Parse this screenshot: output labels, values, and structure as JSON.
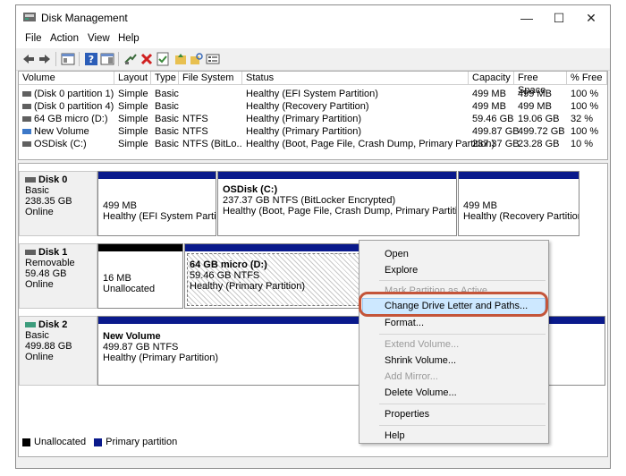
{
  "window": {
    "title": "Disk Management",
    "controls": {
      "minimize": "—",
      "maximize": "☐",
      "close": "✕"
    }
  },
  "menu": [
    "File",
    "Action",
    "View",
    "Help"
  ],
  "table": {
    "headers": [
      "Volume",
      "Layout",
      "Type",
      "File System",
      "Status",
      "Capacity",
      "Free Space",
      "% Free"
    ],
    "rows": [
      [
        "(Disk 0 partition 1)",
        "Simple",
        "Basic",
        "",
        "Healthy (EFI System Partition)",
        "499 MB",
        "499 MB",
        "100 %"
      ],
      [
        "(Disk 0 partition 4)",
        "Simple",
        "Basic",
        "",
        "Healthy (Recovery Partition)",
        "499 MB",
        "499 MB",
        "100 %"
      ],
      [
        "64 GB micro (D:)",
        "Simple",
        "Basic",
        "NTFS",
        "Healthy (Primary Partition)",
        "59.46 GB",
        "19.06 GB",
        "32 %"
      ],
      [
        "New Volume",
        "Simple",
        "Basic",
        "NTFS",
        "Healthy (Primary Partition)",
        "499.87 GB",
        "499.72 GB",
        "100 %"
      ],
      [
        "OSDisk (C:)",
        "Simple",
        "Basic",
        "NTFS (BitLo...",
        "Healthy (Boot, Page File, Crash Dump, Primary Partition)",
        "237.37 GB",
        "23.28 GB",
        "10 %"
      ]
    ]
  },
  "disks": [
    {
      "name": "Disk 0",
      "type": "Basic",
      "size": "238.35 GB",
      "status": "Online",
      "partitions": [
        {
          "title": "",
          "line1": "499 MB",
          "line2": "Healthy (EFI System Partition"
        },
        {
          "title": "OSDisk  (C:)",
          "line1": "237.37 GB NTFS (BitLocker Encrypted)",
          "line2": "Healthy (Boot, Page File, Crash Dump, Primary Partition)"
        },
        {
          "title": "",
          "line1": "499 MB",
          "line2": "Healthy (Recovery Partition)"
        }
      ]
    },
    {
      "name": "Disk 1",
      "type": "Removable",
      "size": "59.48 GB",
      "status": "Online",
      "partitions": [
        {
          "title": "",
          "line1": "16 MB",
          "line2": "Unallocated"
        },
        {
          "title": "64 GB micro  (D:)",
          "line1": "59.46 GB NTFS",
          "line2": "Healthy (Primary Partition)"
        }
      ]
    },
    {
      "name": "Disk 2",
      "type": "Basic",
      "size": "499.88 GB",
      "status": "Online",
      "partitions": [
        {
          "title": "New Volume",
          "line1": "499.87 GB NTFS",
          "line2": "Healthy (Primary Partition)"
        }
      ]
    }
  ],
  "legend": {
    "unallocated": "Unallocated",
    "primary": "Primary partition",
    "unallocated_color": "#000000",
    "primary_color": "#0a1a8c"
  },
  "context_menu": {
    "open": "Open",
    "explore": "Explore",
    "mark_active": "Mark Partition as Active",
    "change_letter": "Change Drive Letter and Paths...",
    "format": "Format...",
    "extend": "Extend Volume...",
    "shrink": "Shrink Volume...",
    "add_mirror": "Add Mirror...",
    "delete": "Delete Volume...",
    "properties": "Properties",
    "help": "Help"
  },
  "colors": {
    "highlight": "#cde8ff",
    "annotation_ring": "#c4553a",
    "partition_bar": "#0a1a8c"
  }
}
